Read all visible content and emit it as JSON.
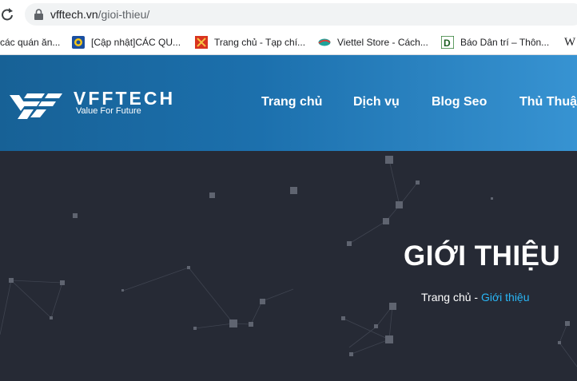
{
  "browser": {
    "url_domain": "vfftech.vn",
    "url_path": "/gioi-thieu/",
    "icons": [
      "reload-icon",
      "lock-icon"
    ],
    "bookmarks": [
      {
        "label": "các quán ăn..."
      },
      {
        "label": "[Cập nhật]CÁC QU..."
      },
      {
        "label": "Trang chủ - Tạp chí..."
      },
      {
        "label": "Viettel Store - Cách..."
      },
      {
        "label": "Báo Dân trí – Thôn..."
      },
      {
        "label": "W"
      }
    ]
  },
  "site": {
    "logo_text": "VFFTECH",
    "logo_tagline": "Value For Future",
    "nav": [
      {
        "label": "Trang chủ"
      },
      {
        "label": "Dịch vụ"
      },
      {
        "label": "Blog Seo"
      },
      {
        "label": "Thủ Thuật"
      }
    ],
    "colors": {
      "header_start": "#176196",
      "header_end": "#3793d2",
      "hero_bg": "#262a35",
      "breadcrumb_active": "#29b6f6"
    }
  },
  "hero": {
    "title": "GIỚI THIỆU",
    "breadcrumb_home": "Trang chủ",
    "breadcrumb_separator": " - ",
    "breadcrumb_current": "Giới thiệu"
  }
}
